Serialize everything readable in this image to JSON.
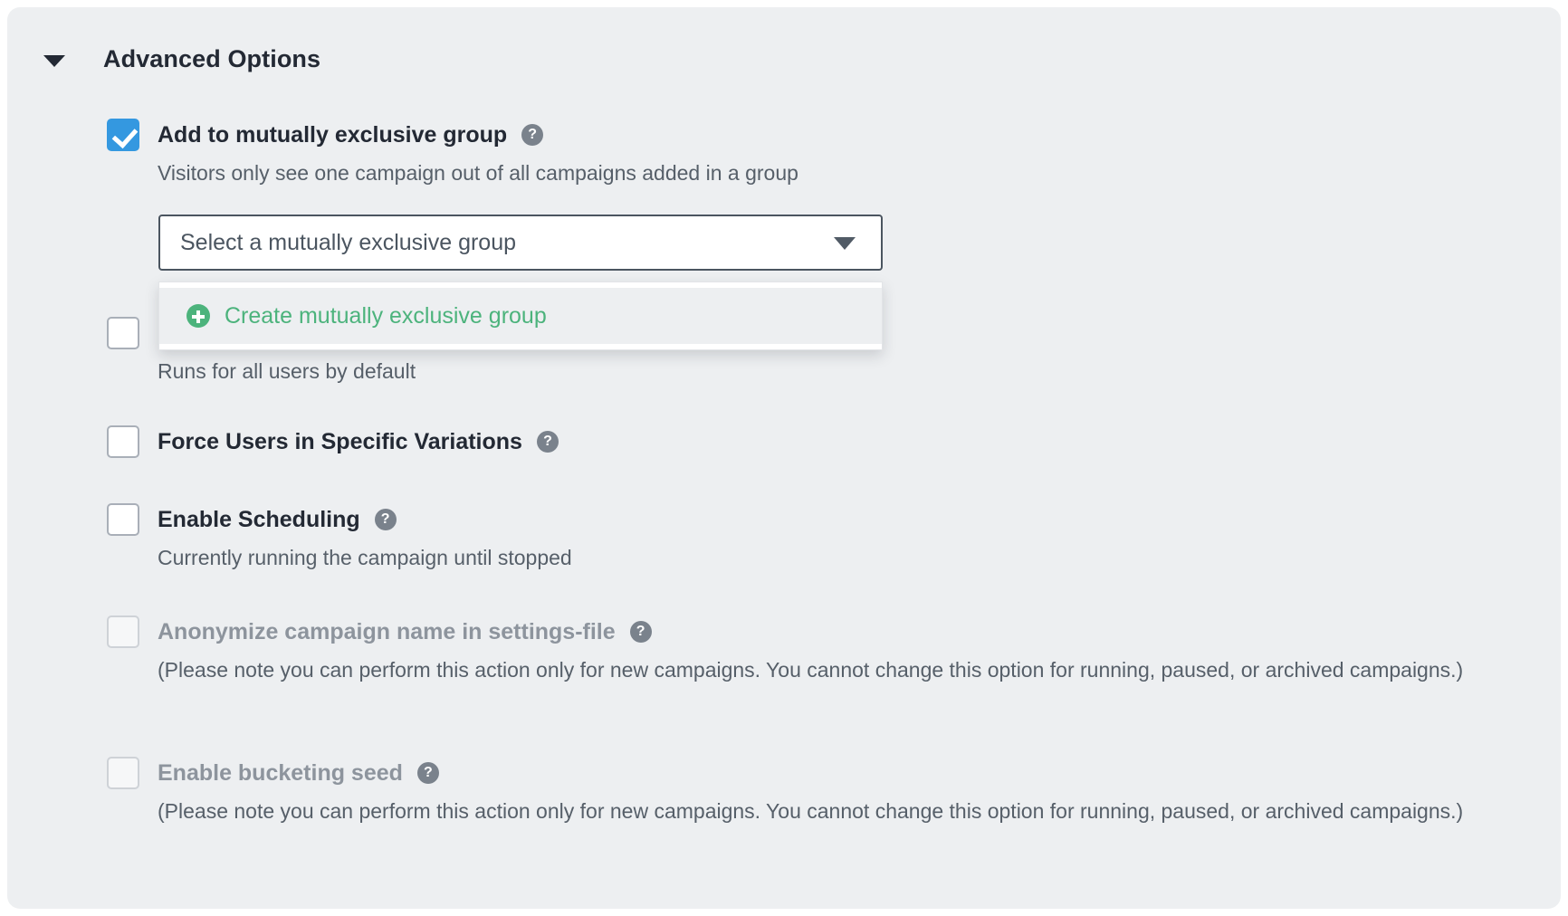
{
  "panel": {
    "header": {
      "title": "Advanced Options",
      "caret_icon": "chevron-down-icon",
      "expanded": true
    },
    "colors": {
      "panel_background": "#edeff1",
      "checkbox_checked": "#3498e0",
      "accent_green": "#4cb37c",
      "text_primary": "#232934",
      "text_secondary": "#565f69",
      "text_disabled": "#8d949d",
      "select_border": "#4b5560"
    },
    "options": [
      {
        "id": "mutually-exclusive-group",
        "label": "Add to mutually exclusive group",
        "description": "Visitors only see one campaign out of all campaigns added in a group",
        "checked": true,
        "disabled": false,
        "help_icon": "question-mark-icon"
      },
      {
        "id": "segment-users",
        "label": "",
        "description": "Runs for all users by default",
        "checked": false,
        "disabled": false,
        "help_icon": "question-mark-icon"
      },
      {
        "id": "force-users-variations",
        "label": "Force Users in Specific Variations",
        "description": "",
        "checked": false,
        "disabled": false,
        "help_icon": "question-mark-icon"
      },
      {
        "id": "enable-scheduling",
        "label": "Enable Scheduling",
        "description": "Currently running the campaign until stopped",
        "checked": false,
        "disabled": false,
        "help_icon": "question-mark-icon"
      },
      {
        "id": "anonymize-campaign-name",
        "label": "Anonymize campaign name in settings-file",
        "description": "(Please note you can perform this action only for new campaigns. You cannot change this option for running, paused, or archived campaigns.)",
        "checked": false,
        "disabled": true,
        "help_icon": "question-mark-icon"
      },
      {
        "id": "enable-bucketing-seed",
        "label": "Enable bucketing seed",
        "description": "(Please note you can perform this action only for new campaigns. You cannot change this option for running, paused, or archived campaigns.)",
        "checked": false,
        "disabled": true,
        "help_icon": "question-mark-icon"
      }
    ],
    "select": {
      "value": "Select a mutually exclusive group",
      "placeholder": "Select a mutually exclusive group",
      "caret_icon": "chevron-down-icon",
      "open": true
    },
    "dropdown": {
      "items": [
        {
          "label": "Create mutually exclusive group",
          "icon": "plus-circle-icon",
          "highlighted": true
        }
      ]
    }
  }
}
